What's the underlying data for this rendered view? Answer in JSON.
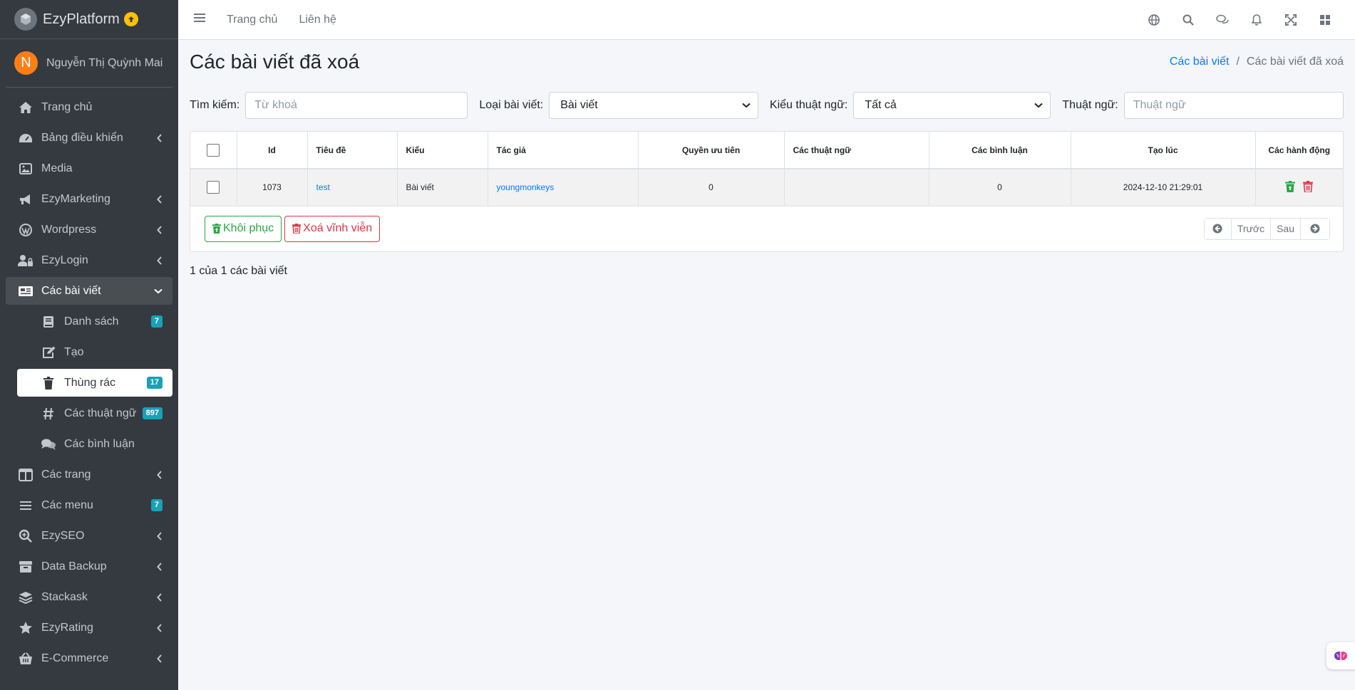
{
  "brand": {
    "name": "EzyPlatform"
  },
  "user": {
    "initial": "N",
    "name": "Nguyễn Thị Quỳnh Mai"
  },
  "sidebar": {
    "items": [
      {
        "label": "Trang chủ",
        "icon": "home-icon"
      },
      {
        "label": "Bảng điều khiển",
        "icon": "dashboard-icon"
      },
      {
        "label": "Media",
        "icon": "image-icon"
      },
      {
        "label": "EzyMarketing",
        "icon": "bullhorn-icon"
      },
      {
        "label": "Wordpress",
        "icon": "wordpress-icon"
      },
      {
        "label": "EzyLogin",
        "icon": "user-lock-icon"
      },
      {
        "label": "Các bài viết",
        "icon": "newspaper-icon"
      },
      {
        "label": "Danh sách",
        "icon": "book-icon",
        "badge": "7"
      },
      {
        "label": "Tạo",
        "icon": "edit-icon"
      },
      {
        "label": "Thùng rác",
        "icon": "trash-icon",
        "badge": "17"
      },
      {
        "label": "Các thuật ngữ",
        "icon": "hashtag-icon",
        "badge": "897"
      },
      {
        "label": "Các bình luận",
        "icon": "comments-icon"
      },
      {
        "label": "Các trang",
        "icon": "columns-icon"
      },
      {
        "label": "Các menu",
        "icon": "bars-icon",
        "badge": "7"
      },
      {
        "label": "EzySEO",
        "icon": "search-plus-icon"
      },
      {
        "label": "Data Backup",
        "icon": "archive-icon"
      },
      {
        "label": "Stackask",
        "icon": "layers-icon"
      },
      {
        "label": "EzyRating",
        "icon": "star-icon"
      },
      {
        "label": "E-Commerce",
        "icon": "basket-icon"
      }
    ]
  },
  "topbar": {
    "home": "Trang chủ",
    "contact": "Liên hệ"
  },
  "page": {
    "title": "Các bài viết đã xoá",
    "breadcrumb": {
      "parent": "Các bài viết",
      "current": "Các bài viết đã xoá"
    }
  },
  "filters": {
    "search_label": "Tìm kiếm:",
    "search_placeholder": "Từ khoá",
    "post_type_label": "Loại bài viết:",
    "post_type_value": "Bài viết",
    "term_type_label": "Kiểu thuật ngữ:",
    "term_type_value": "Tất cả",
    "term_label": "Thuật ngữ:",
    "term_placeholder": "Thuật ngữ"
  },
  "table": {
    "headers": [
      "Id",
      "Tiêu đề",
      "Kiểu",
      "Tác giả",
      "Quyền ưu tiên",
      "Các thuật ngữ",
      "Các bình luận",
      "Tạo lúc",
      "Các hành động"
    ],
    "rows": [
      {
        "id": "1073",
        "title": "test",
        "type": "Bài viết",
        "author": "youngmonkeys",
        "priority": "0",
        "terms": "",
        "comments": "0",
        "created": "2024-12-10 21:29:01"
      }
    ]
  },
  "actions": {
    "restore": "Khôi phục",
    "delete_forever": "Xoá vĩnh viễn"
  },
  "pager": {
    "prev": "Trước",
    "next": "Sau"
  },
  "summary": "1 của 1 các bài viết",
  "colors": {
    "sidebar_bg": "#343a40",
    "link": "#007bff",
    "success": "#28a745",
    "danger": "#dc3545",
    "badge": "#17a2b8"
  }
}
